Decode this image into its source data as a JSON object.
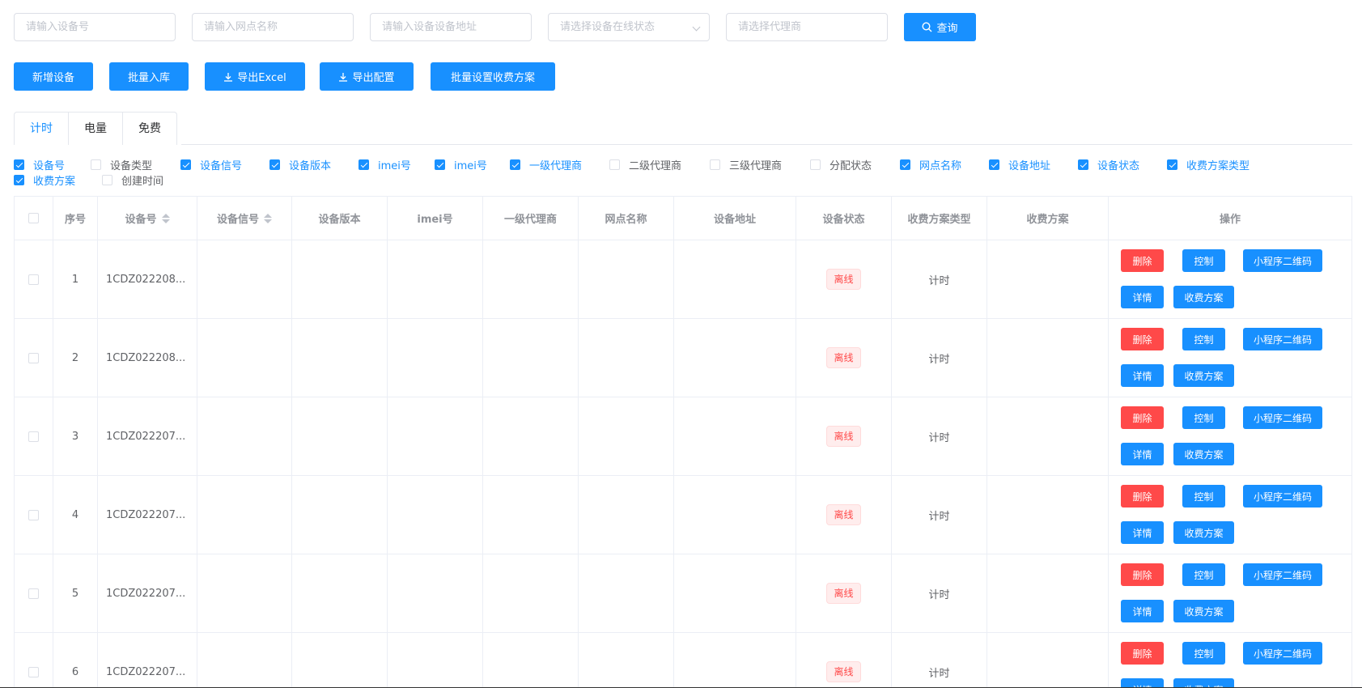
{
  "filters": {
    "device_no_placeholder": "请输入设备号",
    "outlet_name_placeholder": "请输入网点名称",
    "device_address_placeholder": "请输入设备设备地址",
    "online_status_placeholder": "请选择设备在线状态",
    "agent_placeholder": "请选择代理商",
    "query_label": "查询"
  },
  "toolbar": {
    "add_device": "新增设备",
    "batch_import": "批量入库",
    "export_excel": "导出Excel",
    "export_config": "导出配置",
    "batch_fee_plan": "批量设置收费方案"
  },
  "tabs": [
    "计时",
    "电量",
    "免费"
  ],
  "column_toggles": [
    {
      "label": "设备号",
      "checked": true
    },
    {
      "label": "设备类型",
      "checked": false
    },
    {
      "label": "设备信号",
      "checked": true
    },
    {
      "label": "设备版本",
      "checked": true
    },
    {
      "label": "imei号",
      "checked": true
    },
    {
      "label": "imei号",
      "checked": true
    },
    {
      "label": "一级代理商",
      "checked": true
    },
    {
      "label": "二级代理商",
      "checked": false
    },
    {
      "label": "三级代理商",
      "checked": false
    },
    {
      "label": "分配状态",
      "checked": false
    },
    {
      "label": "网点名称",
      "checked": true
    },
    {
      "label": "设备地址",
      "checked": true
    },
    {
      "label": "设备状态",
      "checked": true
    },
    {
      "label": "收费方案类型",
      "checked": true
    },
    {
      "label": "收费方案",
      "checked": true
    },
    {
      "label": "创建时间",
      "checked": false
    }
  ],
  "table": {
    "headers": {
      "index": "序号",
      "device_no": "设备号",
      "signal": "设备信号",
      "version": "设备版本",
      "imei": "imei号",
      "agent1": "一级代理商",
      "outlet": "网点名称",
      "address": "设备地址",
      "status": "设备状态",
      "fee_type": "收费方案类型",
      "fee_plan": "收费方案",
      "ops": "操作"
    },
    "rows": [
      {
        "index": "1",
        "device_no": "1CDZ022208...",
        "status": "离线",
        "fee_type": "计时"
      },
      {
        "index": "2",
        "device_no": "1CDZ022208...",
        "status": "离线",
        "fee_type": "计时"
      },
      {
        "index": "3",
        "device_no": "1CDZ022207...",
        "status": "离线",
        "fee_type": "计时"
      },
      {
        "index": "4",
        "device_no": "1CDZ022207...",
        "status": "离线",
        "fee_type": "计时"
      },
      {
        "index": "5",
        "device_no": "1CDZ022207...",
        "status": "离线",
        "fee_type": "计时"
      },
      {
        "index": "6",
        "device_no": "1CDZ022207...",
        "status": "离线",
        "fee_type": "计时"
      }
    ],
    "row_actions": {
      "delete": "删除",
      "control": "控制",
      "qrcode": "小程序二维码",
      "detail": "详情",
      "fee_plan": "收费方案"
    }
  },
  "colors": {
    "primary": "#1890ff",
    "danger": "#ff4949",
    "offline_tag_bg": "#ffeded"
  },
  "icons": {
    "query": "search-icon",
    "export": "download-icon",
    "select": "chevron-down-icon",
    "sort": "sort-icon"
  }
}
